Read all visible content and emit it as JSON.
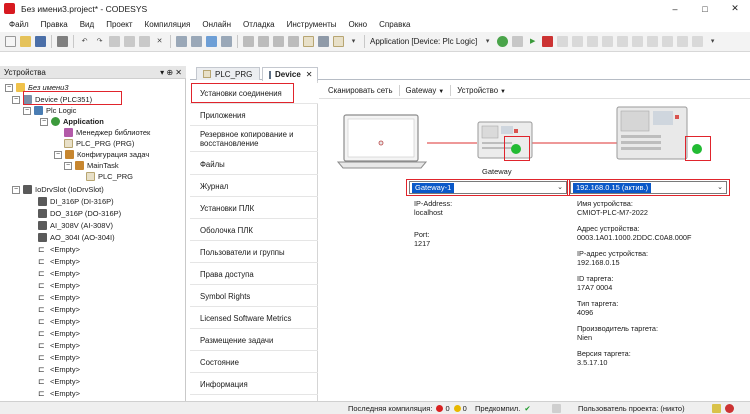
{
  "window": {
    "title": "Без имени3.project* - CODESYS",
    "controls": [
      "–",
      "□",
      "✕"
    ]
  },
  "menu": [
    "Файл",
    "Правка",
    "Вид",
    "Проект",
    "Компиляция",
    "Онлайн",
    "Отладка",
    "Инструменты",
    "Окно",
    "Справка"
  ],
  "toolbar": {
    "application_label": "Application [Device: Plc Logic]"
  },
  "devices_panel": {
    "title": "Устройства",
    "pin": "▾ ⊕ ✕",
    "tree": {
      "project": "Без имени3",
      "device": "Device (PLC351)",
      "plc_logic": "Plc Logic",
      "application": "Application",
      "library_manager": "Менеджер библиотек",
      "plc_prg": "PLC_PRG (PRG)",
      "task_config": "Конфигурация задач",
      "main_task": "MainTask",
      "task_prg": "PLC_PRG",
      "io_slot": "IoDrvSlot (IoDrvSlot)",
      "modules": [
        "DI_316P (DI-316P)",
        "DO_316P (DO-316P)",
        "AI_308V (AI-308V)",
        "AO_304I (AO-304I)"
      ],
      "empty_label": "<Empty>"
    }
  },
  "editor": {
    "tabs": [
      {
        "label": "PLC_PRG",
        "active": false
      },
      {
        "label": "Device",
        "active": true,
        "close": "✕"
      }
    ],
    "nav": [
      "Установки соединения",
      "Приложения",
      "Резервное копирование и восстановление",
      "Файлы",
      "Журнал",
      "Установки ПЛК",
      "Оболочка ПЛК",
      "Пользователи и группы",
      "Права доступа",
      "Symbol Rights",
      "Licensed Software Metrics",
      "Размещение задачи",
      "Состояние",
      "Информация"
    ],
    "subtoolbar": {
      "scan": "Сканировать сеть",
      "gateway": "Gateway",
      "device": "Устройство"
    },
    "gateway_caption": "Gateway",
    "gateway_select": "Gateway-1",
    "device_select": "192.168.0.15 (актив.)",
    "gateway_info": {
      "ip_label": "IP-Address:",
      "ip_value": "localhost",
      "port_label": "Port:",
      "port_value": "1217"
    },
    "device_info": {
      "name_label": "Имя устройства:",
      "name_value": "CMIOT-PLC-M7-2022",
      "addr_label": "Адрес устройства:",
      "addr_value": "0003.1A01.1000.2DDC.C0A8.000F",
      "ip_label": "IP-адрес устройства:",
      "ip_value": "192.168.0.15",
      "target_id_label": "ID таргета:",
      "target_id_value": "17A7 0004",
      "target_type_label": "Тип таргета:",
      "target_type_value": "4096",
      "vendor_label": "Производитель таргета:",
      "vendor_value": "Nien",
      "version_label": "Версия таргета:",
      "version_value": "3.5.17.10"
    }
  },
  "statusbar": {
    "last_build": "Последняя компиляция:",
    "errors": "0",
    "warnings": "0",
    "precompile": "Предкомпил.",
    "precompile_mark": "✔",
    "project_user": "Пользователь проекта: (никто)"
  },
  "colors": {
    "highlight_red": "#e0242c",
    "online_green": "#22bb33",
    "select_blue": "#0a58c8"
  }
}
